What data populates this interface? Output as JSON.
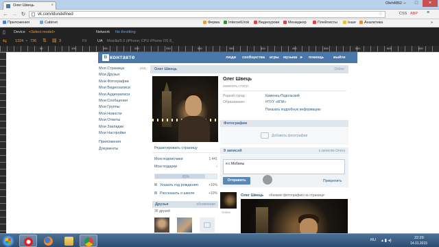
{
  "browser": {
    "tab_title": "Олег Швець",
    "user": "Oleh4852",
    "url": "vk.com/idundefined",
    "extensions": [
      "CSS",
      "ABP"
    ],
    "bookmarks": [
      "Приложения",
      "Cabinet",
      "Ферма",
      "InternetUrok",
      "Видеоуроки",
      "Менеджер",
      "Плейлисты",
      "Інше",
      "Аналитика"
    ],
    "bookmarks_more": "»"
  },
  "devtools": {
    "device_label": "Device",
    "device_value": "<Select model>",
    "network_label": "Network",
    "network_value": "No throttling",
    "width": "1324",
    "times": "×",
    "height": "736",
    "zoom": "3",
    "fit": "Fit",
    "ua_label": "UA",
    "ua_value": "Mozilla/5.0 (iPhone; CPU iPhone OS 8_",
    "ruler_nums": [
      "50",
      "100",
      "150",
      "200",
      "250",
      "300",
      "350",
      "400",
      "450",
      "500",
      "550",
      "600",
      "650"
    ]
  },
  "vk": {
    "logo_box": "В",
    "logo_text": "контакте",
    "nav": [
      "люди",
      "сообщества",
      "игры",
      "музыка",
      "помощь",
      "выйти"
    ],
    "menu": [
      "Моя Страница",
      "Мои Друзья",
      "Мои Фотографии",
      "Мои Видеозаписи",
      "Мои Аудиозаписи",
      "Мои Сообщения",
      "Мои Группы",
      "Мои Новости",
      "Мои Ответы",
      "Мои Закладки",
      "Мои Настройки"
    ],
    "menu_edit": "ред.",
    "menu_extra": [
      "Приложения",
      "Документы"
    ],
    "profile": {
      "header_name": "Олег Швець",
      "online": "Online",
      "name": "Олег Швець",
      "status_prompt": "изменить статус",
      "fields": [
        {
          "label": "Родной город:",
          "value": "Каменец-Подольский"
        },
        {
          "label": "Образование:",
          "value": "НТУУ «КПИ»"
        }
      ],
      "show_more": "Показать подробную информацию"
    },
    "left": {
      "edit_page": "Редактировать страницу",
      "subscribers": "Мои подписчики",
      "subscribers_count": "1 441",
      "gifts": "Мои подарки",
      "progress_label": "81%",
      "progress_value": 81,
      "tips": [
        {
          "text": "Указать год рождения",
          "pct": "+10%"
        },
        {
          "text": "Рассказать о школе",
          "pct": "+10%"
        }
      ],
      "friends_title": "Друзья",
      "friends_updates": "обновления",
      "friends_count": "36 друзей"
    },
    "photos": {
      "title": "Фотографии",
      "add": "Добавить фотографии"
    },
    "wall": {
      "count": "9 записей",
      "filter": "к записям Олега",
      "input_text": "я с Мобилы",
      "send": "Отправить",
      "attach": "Прикрепить"
    },
    "post": {
      "author": "Олег Швець",
      "action": "обновил фотографию на странице:",
      "online": "Online"
    }
  },
  "taskbar": {
    "lang": "RU",
    "time": "22:29",
    "date": "14.01.2015"
  },
  "colors": {
    "vk_blue": "#4a76a8",
    "devtools_bg": "#222222",
    "taskbar": "#2c4e74"
  }
}
